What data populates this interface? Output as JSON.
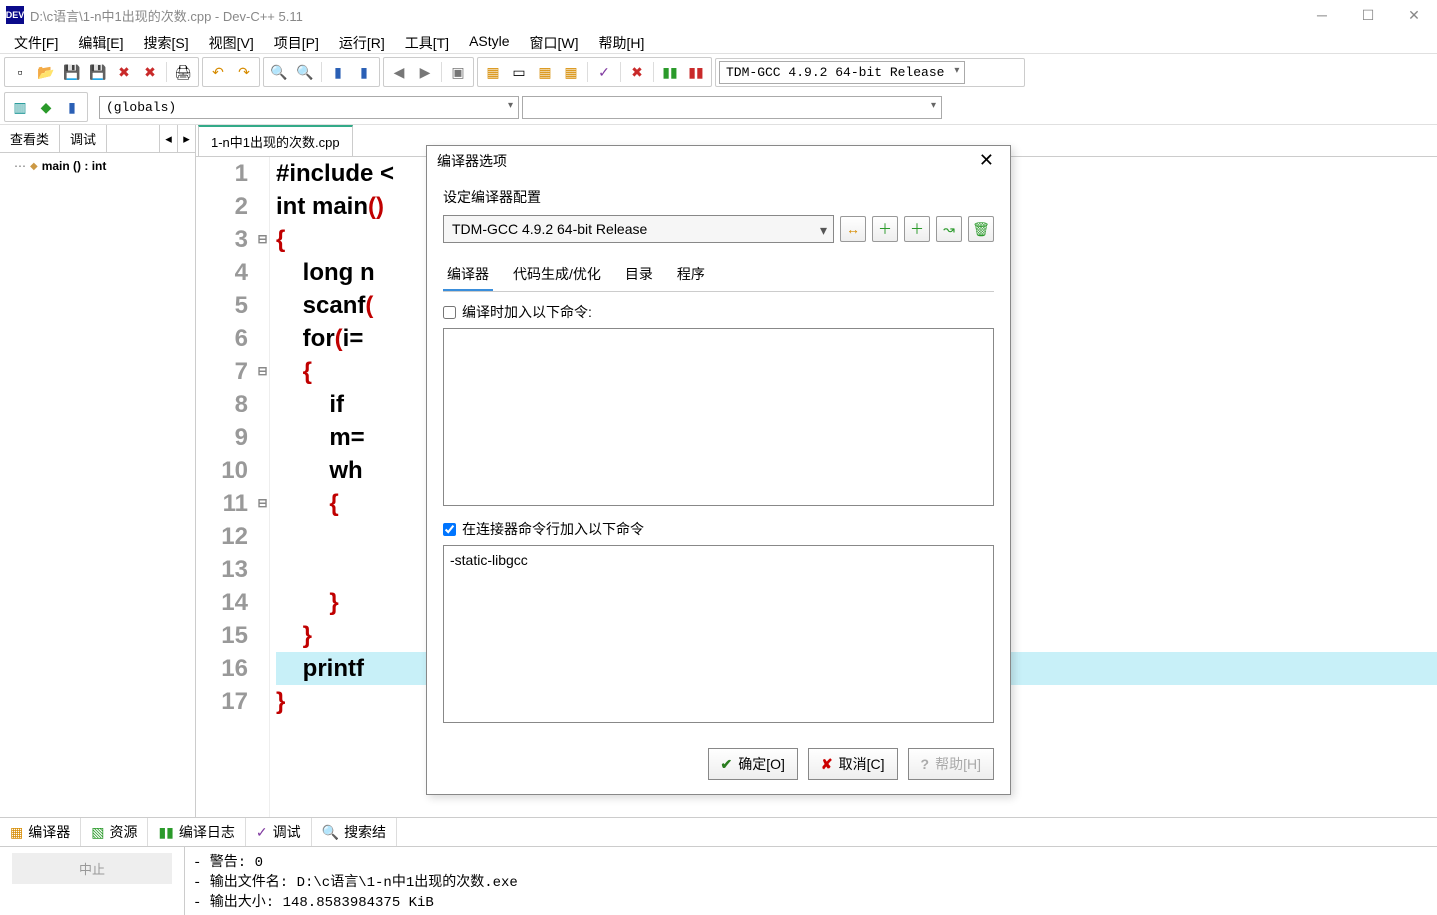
{
  "titlebar": {
    "icon_label": "DEV",
    "title": "D:\\c语言\\1-n中1出现的次数.cpp - Dev-C++ 5.11"
  },
  "menu": {
    "items": [
      "文件[F]",
      "编辑[E]",
      "搜索[S]",
      "视图[V]",
      "项目[P]",
      "运行[R]",
      "工具[T]",
      "AStyle",
      "窗口[W]",
      "帮助[H]"
    ]
  },
  "toolbar": {
    "compiler_combo": "TDM-GCC 4.9.2 64-bit Release",
    "globals_combo": "(globals)"
  },
  "left_tabs": {
    "tab1": "查看类",
    "tab2": "调试"
  },
  "tree": {
    "main_fn": "main () : int"
  },
  "file_tab": "1-n中1出现的次数.cpp",
  "code_lines": [
    {
      "n": "1",
      "txt": "#include <",
      "fold": ""
    },
    {
      "n": "2",
      "txt": "int main()",
      "fold": ""
    },
    {
      "n": "3",
      "txt": "{",
      "fold": "⊟"
    },
    {
      "n": "4",
      "txt": "    long n",
      "fold": ""
    },
    {
      "n": "5",
      "txt": "    scanf(",
      "fold": ""
    },
    {
      "n": "6",
      "txt": "    for(i=",
      "fold": ""
    },
    {
      "n": "7",
      "txt": "    {",
      "fold": "⊟"
    },
    {
      "n": "8",
      "txt": "        if",
      "fold": ""
    },
    {
      "n": "9",
      "txt": "        m=",
      "fold": ""
    },
    {
      "n": "10",
      "txt": "        wh",
      "fold": ""
    },
    {
      "n": "11",
      "txt": "        {",
      "fold": "⊟"
    },
    {
      "n": "12",
      "txt": "",
      "fold": ""
    },
    {
      "n": "13",
      "txt": "",
      "fold": ""
    },
    {
      "n": "14",
      "txt": "        }",
      "fold": ""
    },
    {
      "n": "15",
      "txt": "    }",
      "fold": ""
    },
    {
      "n": "16",
      "txt": "    printf",
      "fold": "",
      "hl": true
    },
    {
      "n": "17",
      "txt": "}",
      "fold": ""
    }
  ],
  "dialog": {
    "title": "编译器选项",
    "section": "设定编译器配置",
    "combo_value": "TDM-GCC 4.9.2 64-bit Release",
    "tabs": [
      "编译器",
      "代码生成/优化",
      "目录",
      "程序"
    ],
    "check1_label": "编译时加入以下命令:",
    "check1_checked": false,
    "area1_value": "",
    "check2_label": "在连接器命令行加入以下命令",
    "check2_checked": true,
    "area2_value": "-static-libgcc",
    "ok": "确定[O]",
    "cancel": "取消[C]",
    "help": "帮助[H]"
  },
  "bottom": {
    "tabs": [
      "编译器",
      "资源",
      "编译日志",
      "调试",
      "搜索结"
    ],
    "abort": "中止",
    "log_lines": [
      "- 警告: 0",
      "- 输出文件名: D:\\c语言\\1-n中1出现的次数.exe",
      "- 输出大小: 148.8583984375 KiB"
    ]
  }
}
